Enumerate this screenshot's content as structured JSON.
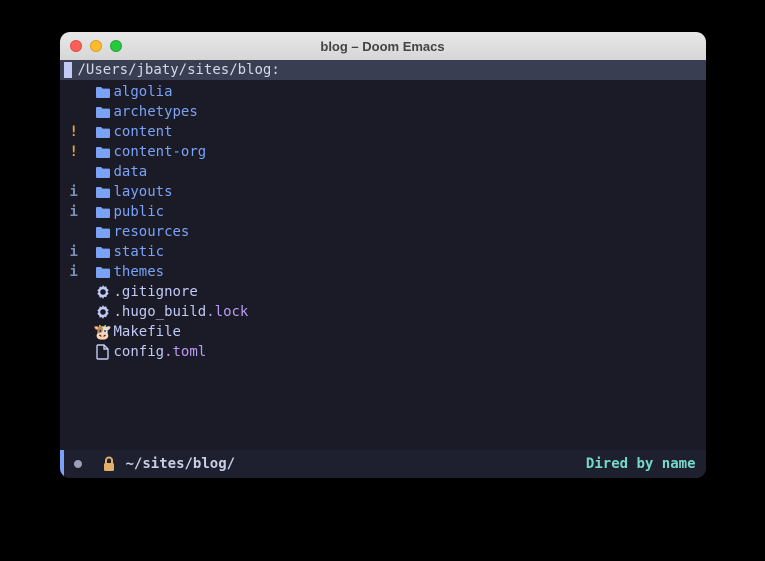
{
  "window": {
    "title": "blog – Doom Emacs"
  },
  "header": {
    "path": "/Users/jbaty/sites/blog:"
  },
  "entries": [
    {
      "mark": "",
      "type": "dir",
      "name": "algolia",
      "ext": ""
    },
    {
      "mark": "",
      "type": "dir",
      "name": "archetypes",
      "ext": ""
    },
    {
      "mark": "!",
      "type": "dir",
      "name": "content",
      "ext": ""
    },
    {
      "mark": "!",
      "type": "dir",
      "name": "content-org",
      "ext": ""
    },
    {
      "mark": "",
      "type": "dir",
      "name": "data",
      "ext": ""
    },
    {
      "mark": "i",
      "type": "dir",
      "name": "layouts",
      "ext": ""
    },
    {
      "mark": "i",
      "type": "dir",
      "name": "public",
      "ext": ""
    },
    {
      "mark": "",
      "type": "dir",
      "name": "resources",
      "ext": ""
    },
    {
      "mark": "i",
      "type": "dir",
      "name": "static",
      "ext": ""
    },
    {
      "mark": "i",
      "type": "dir",
      "name": "themes",
      "ext": ""
    },
    {
      "mark": "",
      "type": "gear",
      "name": ".gitignore",
      "ext": ""
    },
    {
      "mark": "",
      "type": "gear",
      "name": ".hugo_build",
      "ext": ".lock"
    },
    {
      "mark": "",
      "type": "gnu",
      "name": "Makefile",
      "ext": ""
    },
    {
      "mark": "",
      "type": "file",
      "name": "config",
      "ext": ".toml"
    }
  ],
  "modeline": {
    "path": "~/sites/blog/",
    "mode": "Dired by name"
  }
}
